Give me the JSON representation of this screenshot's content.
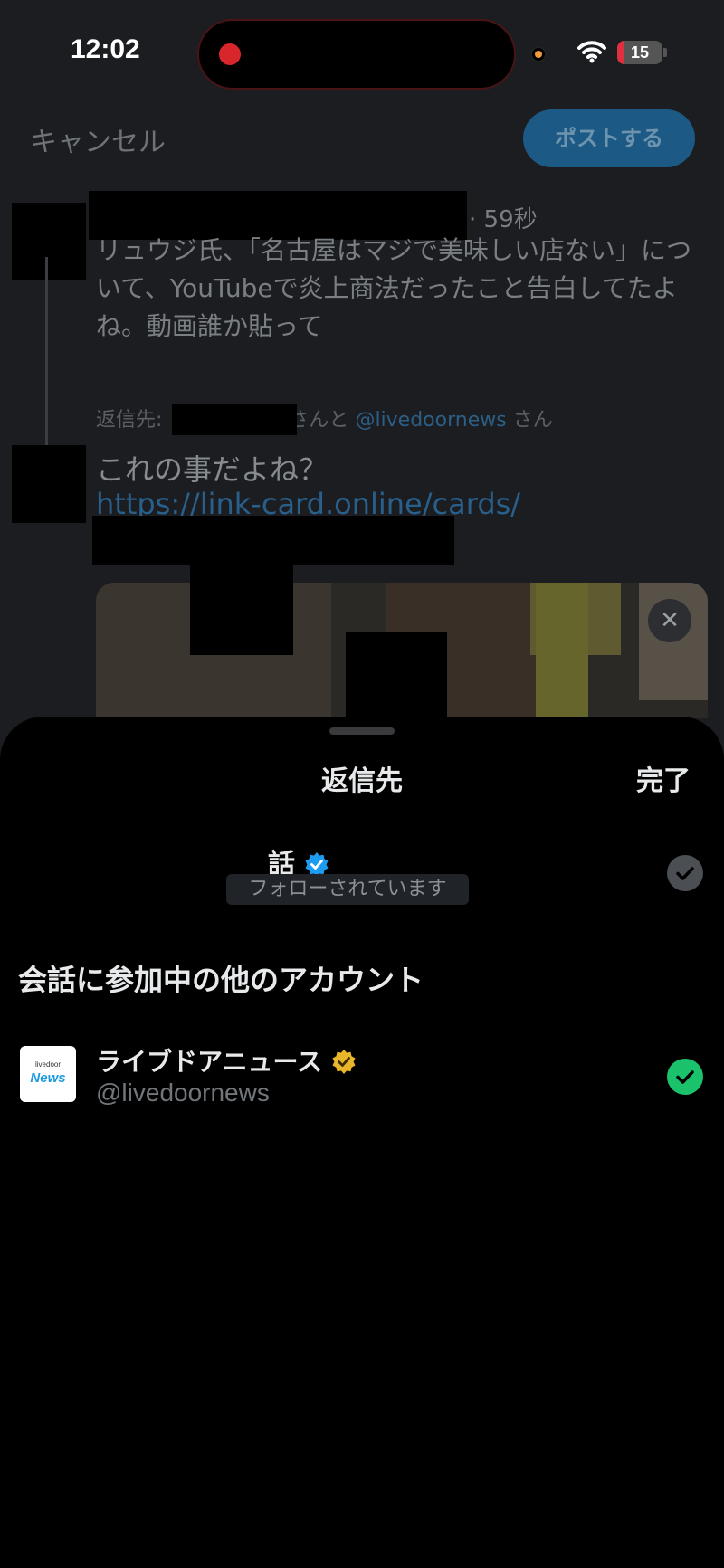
{
  "status_bar": {
    "time": "12:02",
    "battery_level": "15",
    "battery_fraction": 0.15,
    "recording_dot_color": "#d9262c"
  },
  "compose": {
    "cancel_label": "キャンセル",
    "post_label": "ポストする",
    "tweet_time": "59秒",
    "tweet_text": "リュウジ氏、「名古屋はマジで美味しい店ない」について、YouTubeで炎上商法だったこと告白してたよね。動画誰か貼って",
    "reply_prefix": "返信先:",
    "reply_suffix_mid": "さんと",
    "reply_handle": "@livedoornews",
    "reply_suffix_end": "さん",
    "compose_text": "これの事だよね？",
    "compose_link": "https://link-card.online/cards/"
  },
  "sheet": {
    "title": "返信先",
    "done_label": "完了",
    "primary_account": {
      "name_visible": "話",
      "verified_color": "#1d9bf0",
      "follow_status": "フォローされています",
      "selected": true
    },
    "section_title": "会話に参加中の他のアカウント",
    "other_accounts": [
      {
        "name": "ライブドアニュース",
        "handle": "@livedoornews",
        "logo_small": "livedoor",
        "logo_big": "News",
        "verified_color": "#e8b52b",
        "selected": true
      }
    ]
  },
  "colors": {
    "accent_blue": "#1d9bf0",
    "success_green": "#19c26b",
    "gold_badge": "#e8b52b"
  }
}
